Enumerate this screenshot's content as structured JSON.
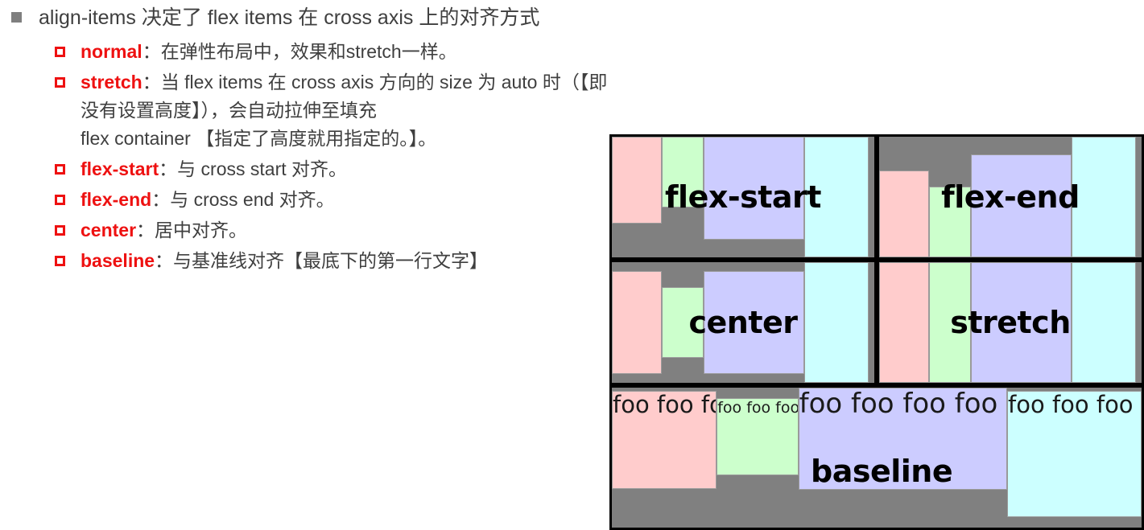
{
  "outline": {
    "level1": {
      "marker": "filled-square-bullet",
      "text": "align-items 决定了 flex items 在 cross axis 上的对齐方式"
    },
    "items": [
      {
        "marker": "hollow-square-bullet",
        "keyword": "normal",
        "separator": "：",
        "desc": "在弹性布局中，效果和stretch一样。",
        "desc_cont": ""
      },
      {
        "marker": "hollow-square-bullet",
        "keyword": "stretch",
        "separator": "：",
        "desc": "当 flex items 在 cross axis 方向的 size 为 auto 时（【即没有设置高度】），会自动拉伸至填充",
        "desc_cont": "flex container 【指定了高度就用指定的。】。"
      },
      {
        "marker": "hollow-square-bullet",
        "keyword": "flex-start",
        "separator": "：",
        "desc": "与 cross start 对齐。",
        "desc_cont": ""
      },
      {
        "marker": "hollow-square-bullet",
        "keyword": "flex-end",
        "separator": "：",
        "desc": "与 cross end 对齐。",
        "desc_cont": ""
      },
      {
        "marker": "hollow-square-bullet",
        "keyword": "center",
        "separator": "：",
        "desc": "居中对齐。",
        "desc_cont": ""
      },
      {
        "marker": "hollow-square-bullet",
        "keyword": "baseline",
        "separator": "：",
        "desc": "与基准线对齐【最底下的第一行文字】",
        "desc_cont": ""
      }
    ]
  },
  "figure": {
    "panels": [
      {
        "id": "flex-start",
        "label": "flex-start",
        "align": "flex-start"
      },
      {
        "id": "flex-end",
        "label": "flex-end",
        "align": "flex-end"
      },
      {
        "id": "center",
        "label": "center",
        "align": "center"
      },
      {
        "id": "stretch",
        "label": "stretch",
        "align": "stretch"
      },
      {
        "id": "baseline",
        "label": "baseline",
        "align": "baseline"
      }
    ],
    "baseline_items": [
      {
        "color": "pink",
        "text": "foo foo foo"
      },
      {
        "color": "green",
        "text": "foo foo foo"
      },
      {
        "color": "purple",
        "text": "foo foo foo foo foo"
      },
      {
        "color": "cyan",
        "text": "foo foo foo"
      }
    ],
    "colors": {
      "pink": "#ffcccc",
      "green": "#ccffcc",
      "purple": "#ccccff",
      "cyan": "#ccffff",
      "container": "#808080",
      "border": "#000000",
      "keyword": "#ee1111"
    }
  }
}
